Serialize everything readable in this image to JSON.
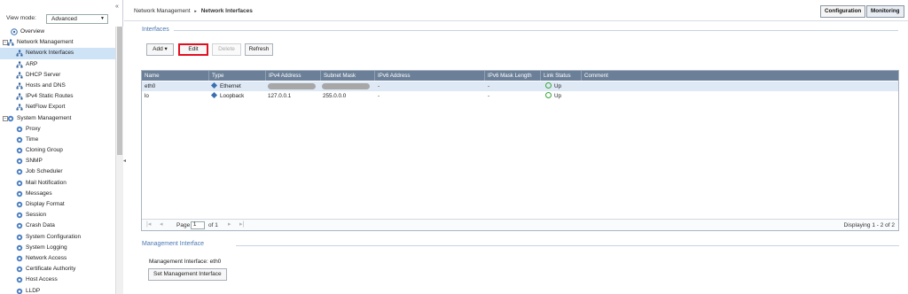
{
  "sidebar": {
    "collapse_glyph": "«",
    "view_mode_label": "View mode:",
    "view_mode_value": "Advanced",
    "tree": [
      {
        "label": "Overview",
        "icon": "overview-icon",
        "level": "root",
        "selected": false
      },
      {
        "label": "Network Management",
        "icon": "network-icon",
        "level": "lvl0",
        "expand": "−",
        "selected": false
      },
      {
        "label": "Network Interfaces",
        "icon": "network-icon",
        "level": "lvl1",
        "selected": true
      },
      {
        "label": "ARP",
        "icon": "network-icon",
        "level": "lvl1"
      },
      {
        "label": "DHCP Server",
        "icon": "network-icon",
        "level": "lvl1"
      },
      {
        "label": "Hosts and DNS",
        "icon": "network-icon",
        "level": "lvl1"
      },
      {
        "label": "IPv4 Static Routes",
        "icon": "network-icon",
        "level": "lvl1"
      },
      {
        "label": "NetFlow Export",
        "icon": "network-icon",
        "level": "lvl1"
      },
      {
        "label": "System Management",
        "icon": "gear-icon",
        "level": "lvl0",
        "expand": "−"
      },
      {
        "label": "Proxy",
        "icon": "gear-icon",
        "level": "lvl1"
      },
      {
        "label": "Time",
        "icon": "gear-icon",
        "level": "lvl1"
      },
      {
        "label": "Cloning Group",
        "icon": "gear-icon",
        "level": "lvl1"
      },
      {
        "label": "SNMP",
        "icon": "gear-icon",
        "level": "lvl1"
      },
      {
        "label": "Job Scheduler",
        "icon": "gear-icon",
        "level": "lvl1"
      },
      {
        "label": "Mail Notification",
        "icon": "gear-icon",
        "level": "lvl1"
      },
      {
        "label": "Messages",
        "icon": "gear-icon",
        "level": "lvl1"
      },
      {
        "label": "Display Format",
        "icon": "gear-icon",
        "level": "lvl1"
      },
      {
        "label": "Session",
        "icon": "gear-icon",
        "level": "lvl1"
      },
      {
        "label": "Crash Data",
        "icon": "gear-icon",
        "level": "lvl1"
      },
      {
        "label": "System Configuration",
        "icon": "gear-icon",
        "level": "lvl1"
      },
      {
        "label": "System Logging",
        "icon": "gear-icon",
        "level": "lvl1"
      },
      {
        "label": "Network Access",
        "icon": "gear-icon",
        "level": "lvl1"
      },
      {
        "label": "Certificate Authority",
        "icon": "gear-icon",
        "level": "lvl1"
      },
      {
        "label": "Host Access",
        "icon": "gear-icon",
        "level": "lvl1"
      },
      {
        "label": "LLDP",
        "icon": "gear-icon",
        "level": "lvl1"
      }
    ]
  },
  "header": {
    "breadcrumb_parent": "Network Management",
    "breadcrumb_sep": "▸",
    "breadcrumb_current": "Network Interfaces",
    "configuration_label": "Configuration",
    "monitoring_label": "Monitoring"
  },
  "interfaces": {
    "title": "Interfaces",
    "toolbar": {
      "add_label": "Add ▾",
      "edit_label": "Edit",
      "delete_label": "Delete",
      "refresh_label": "Refresh"
    },
    "columns": [
      "Name",
      "Type",
      "IPv4 Address",
      "Subnet Mask",
      "IPv6 Address",
      "IPv6 Mask Length",
      "Link Status",
      "Comment"
    ],
    "rows": [
      {
        "name": "eth0",
        "type": "Ethernet",
        "ipv4": "",
        "mask": "",
        "ipv6": "-",
        "ipv6_mask": "-",
        "status": "Up",
        "comment": "",
        "redacted": true
      },
      {
        "name": "lo",
        "type": "Loopback",
        "ipv4": "127.0.0.1",
        "mask": "255.0.0.0",
        "ipv6": "-",
        "ipv6_mask": "-",
        "status": "Up",
        "comment": "",
        "redacted": false
      }
    ],
    "pager": {
      "page_label": "Page",
      "page_value": "1",
      "of_label": "of 1",
      "display_text": "Displaying 1 - 2 of 2"
    }
  },
  "management": {
    "title": "Management Interface",
    "current_text": "Management Interface: eth0",
    "set_button_label": "Set Management Interface"
  },
  "colors": {
    "header_bg": "#6b8098",
    "selected_row": "#dfe9f6",
    "section_title": "#4a78b2",
    "edit_highlight": "#e01020",
    "status_ok": "#3aa63a"
  }
}
